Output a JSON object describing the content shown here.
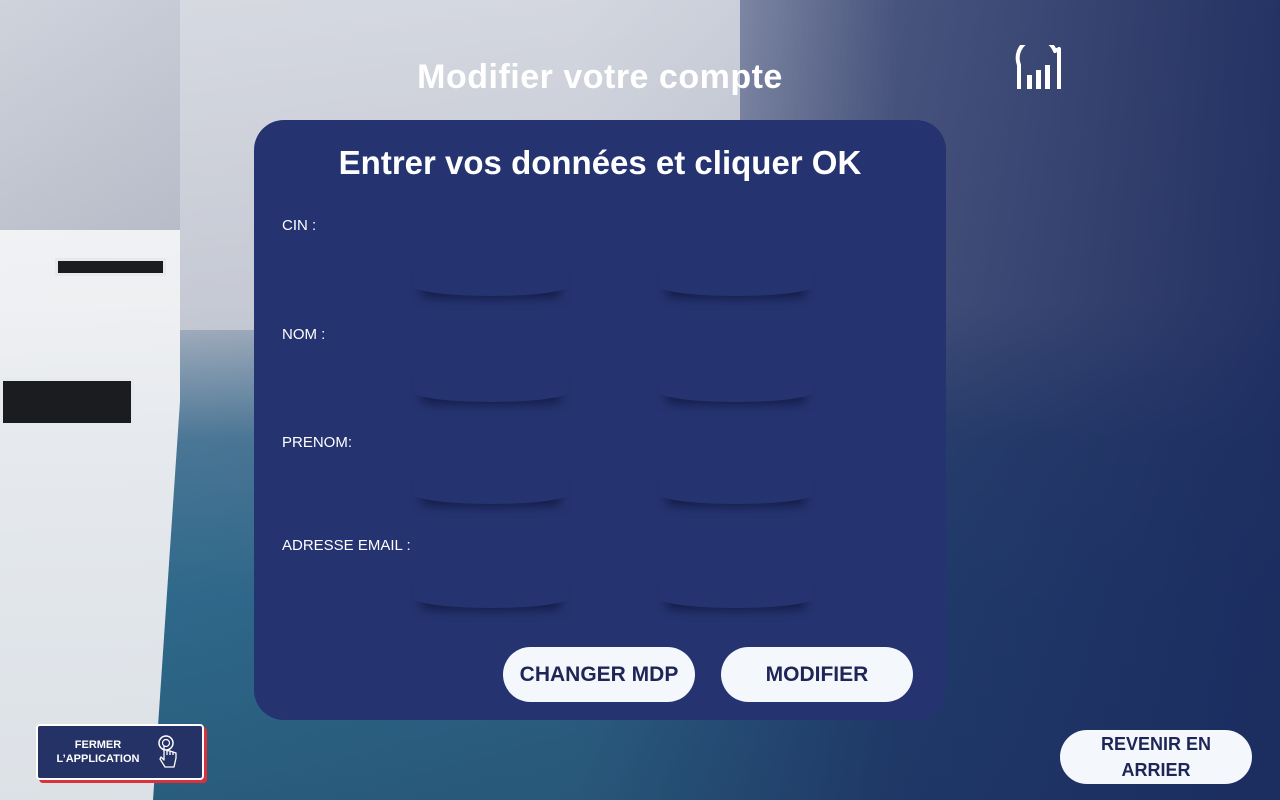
{
  "header": {
    "title": "Modifier votre compte"
  },
  "form": {
    "heading": "Entrer vos données et cliquer OK",
    "fields": [
      {
        "label": "CIN :",
        "value": ""
      },
      {
        "label": "NOM :",
        "value": ""
      },
      {
        "label": "PRENOM:",
        "value": ""
      },
      {
        "label": "ADRESSE EMAIL :",
        "value": ""
      }
    ],
    "change_password_label": "CHANGER MDP",
    "modify_label": "MODIFIER"
  },
  "footer": {
    "close_app_label": "FERMER L’APPLICATION",
    "back_label": "REVENIR EN ARRIER"
  },
  "icons": {
    "logo": "bar-chart-logo-icon",
    "close": "touch-hand-icon"
  },
  "colors": {
    "card": "#253370",
    "page_bg": "#1b2a5e",
    "button_bg": "#f4f7fb",
    "button_text": "#1e2657",
    "close_accent": "#d9323b"
  }
}
